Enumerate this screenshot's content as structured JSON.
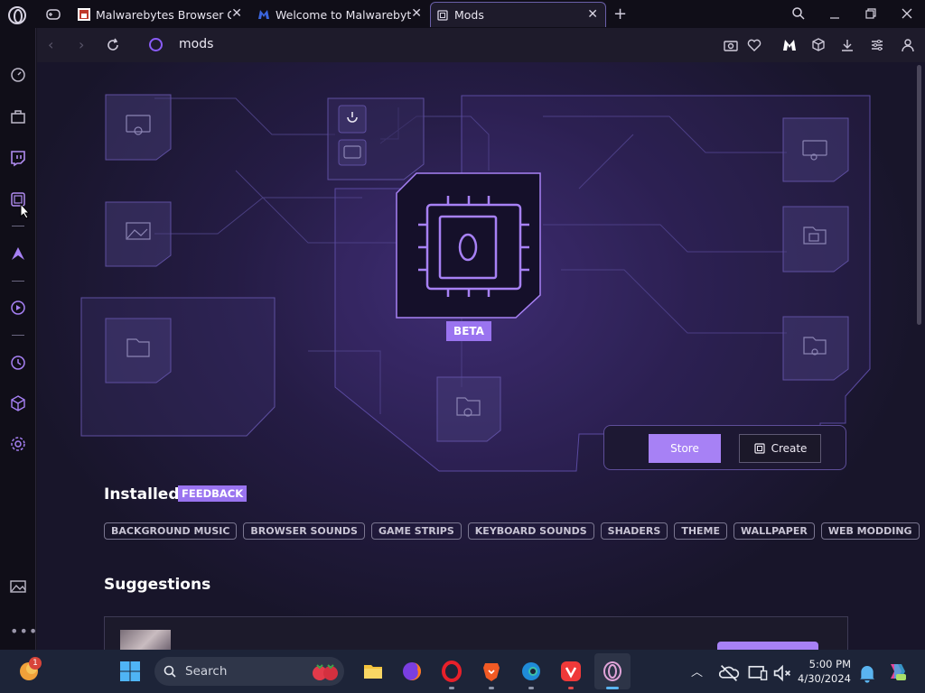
{
  "browser": {
    "tabs": [
      {
        "title": "Malwarebytes Browser Gua",
        "active": false
      },
      {
        "title": "Welcome to Malwarebytes",
        "active": false
      },
      {
        "title": "Mods",
        "active": true
      }
    ],
    "new_tab_label": "+"
  },
  "addressbar": {
    "url": "mods"
  },
  "hero": {
    "beta_label": "BETA",
    "store_label": "Store",
    "create_label": "Create"
  },
  "installed": {
    "title": "Installed",
    "feedback_label": "FEEDBACK",
    "categories": [
      "BACKGROUND MUSIC",
      "BROWSER SOUNDS",
      "GAME STRIPS",
      "KEYBOARD SOUNDS",
      "SHADERS",
      "THEME",
      "WALLPAPER",
      "WEB MODDING"
    ]
  },
  "suggestions": {
    "title": "Suggestions"
  },
  "taskbar": {
    "search_placeholder": "Search",
    "notification_count": "1",
    "time": "5:00 PM",
    "date": "4/30/2024"
  },
  "colors": {
    "accent": "#a781f5",
    "background": "#18152a",
    "taskbar": "#1d2438"
  }
}
